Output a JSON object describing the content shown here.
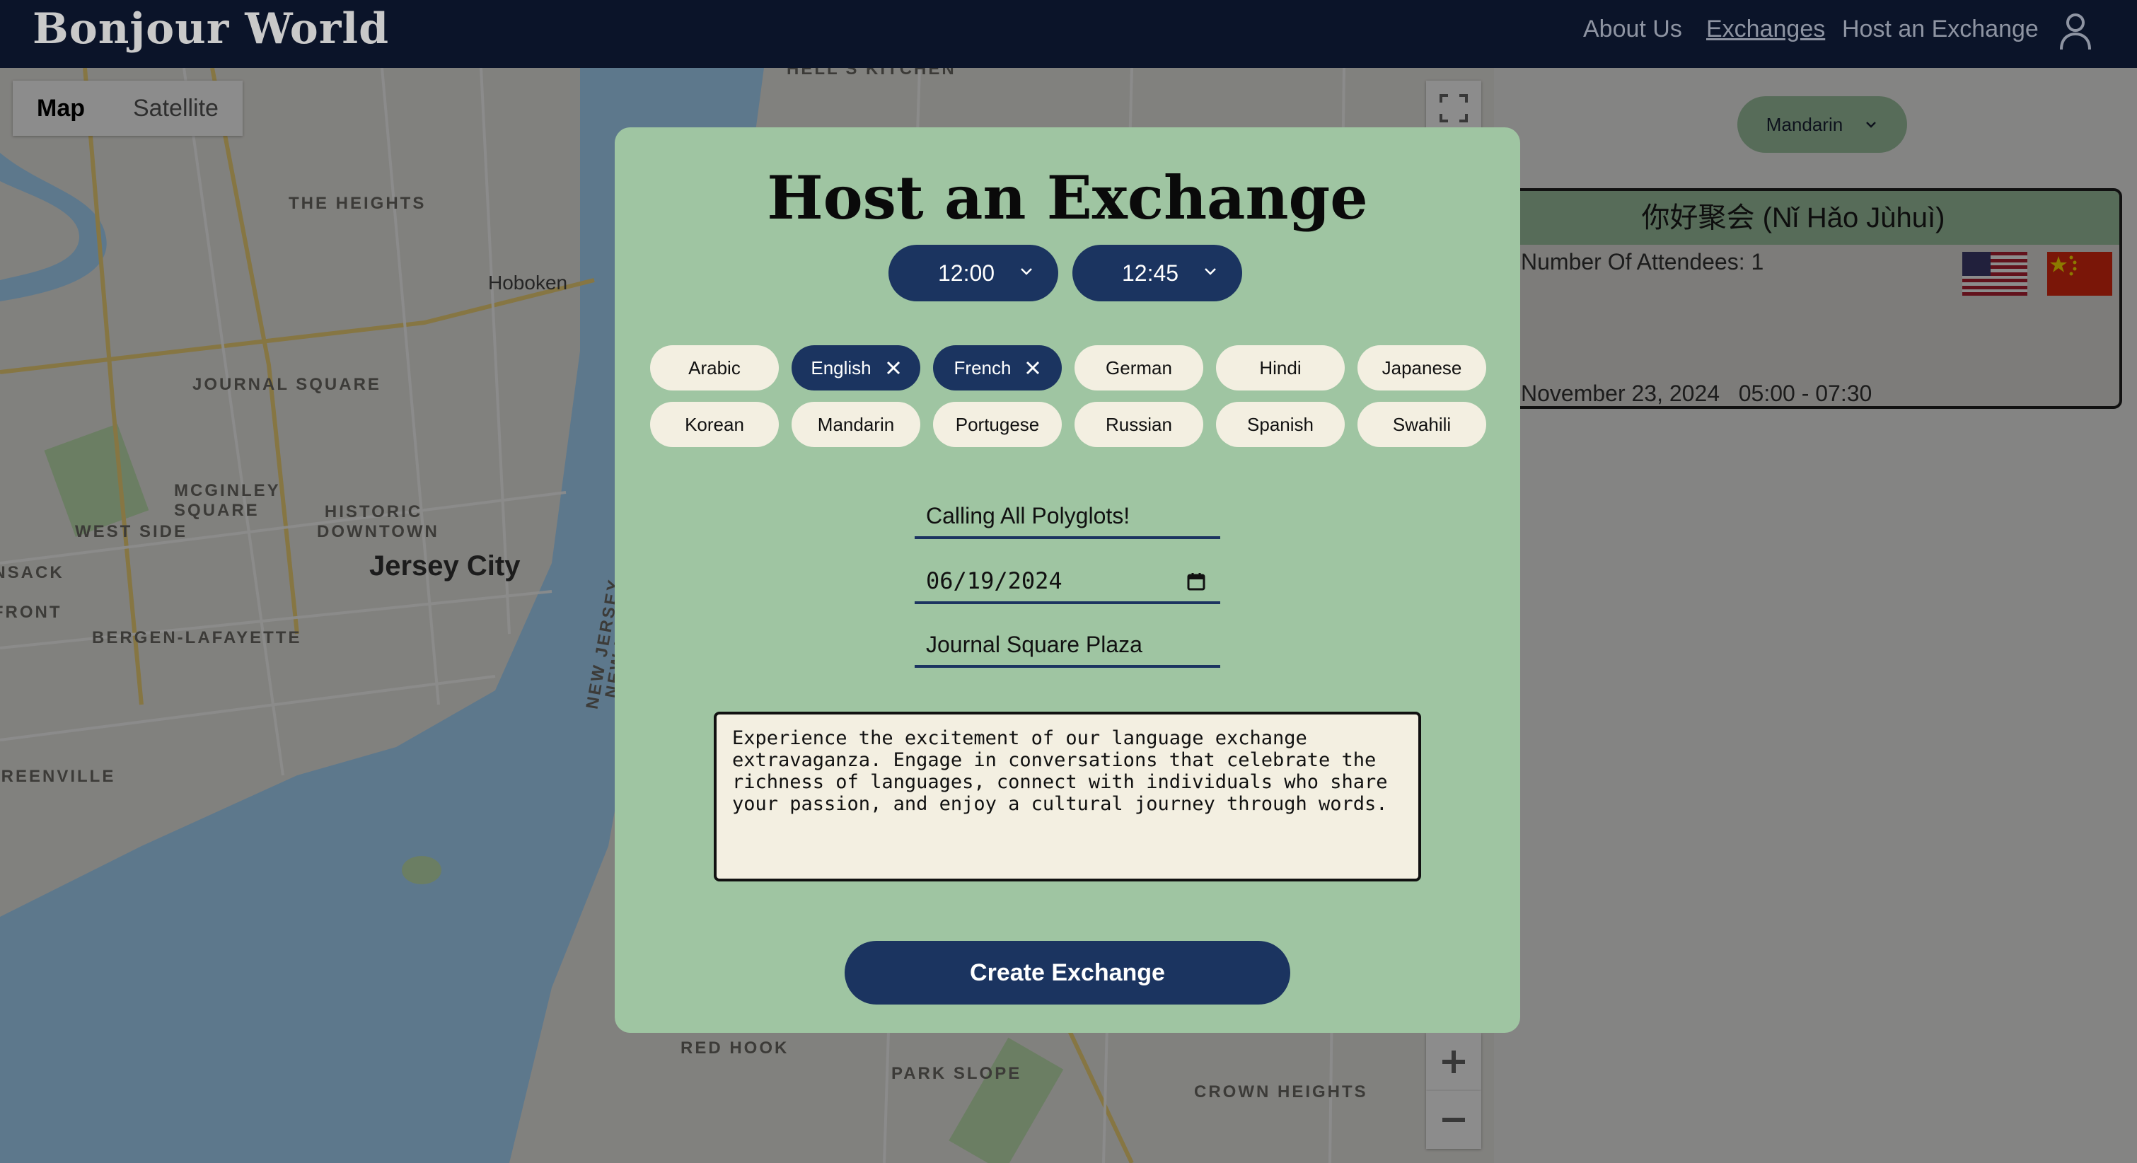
{
  "header": {
    "brand": "Bonjour World",
    "nav": [
      "About Us",
      "Exchanges",
      "Host an Exchange"
    ],
    "active_nav": "Exchanges",
    "user_icon": "user-icon"
  },
  "map": {
    "type_buttons": [
      "Map",
      "Satellite"
    ],
    "selected_type": "Map",
    "labels": [
      "HELL'S KITCHEN",
      "THE HEIGHTS",
      "Hoboken",
      "JOURNAL SQUARE",
      "MCGINLEY SQUARE",
      "WEST SIDE",
      "HISTORIC DOWNTOWN",
      "Jersey City",
      "BERGEN-LAFAYETTE",
      "GREENVILLE",
      "NEW JERSEY",
      "NEW YORK",
      "RED HOOK",
      "PARK SLOPE",
      "CROWN HEIGHTS",
      "HACKENSACK RIVER WATERFRONT"
    ],
    "controls": [
      "fullscreen-icon",
      "zoom-in-icon",
      "zoom-out-icon"
    ]
  },
  "filter": {
    "selected_language": "Mandarin"
  },
  "event_card": {
    "title": "你好聚会 (Nǐ Hǎo Jùhuì)",
    "attendees": "Number Of Attendees: 1",
    "date": "November 23, 2024",
    "time": "05:00 - 07:30",
    "flags": [
      "us-flag-icon",
      "china-flag-icon"
    ]
  },
  "modal": {
    "title": "Host an Exchange",
    "start_time": "12:00",
    "end_time": "12:45",
    "languages": [
      {
        "label": "Arabic",
        "selected": false
      },
      {
        "label": "English",
        "selected": true
      },
      {
        "label": "French",
        "selected": true
      },
      {
        "label": "German",
        "selected": false
      },
      {
        "label": "Hindi",
        "selected": false
      },
      {
        "label": "Japanese",
        "selected": false
      },
      {
        "label": "Korean",
        "selected": false
      },
      {
        "label": "Mandarin",
        "selected": false
      },
      {
        "label": "Portugese",
        "selected": false
      },
      {
        "label": "Russian",
        "selected": false
      },
      {
        "label": "Spanish",
        "selected": false
      },
      {
        "label": "Swahili",
        "selected": false
      }
    ],
    "event_name": "Calling All Polyglots!",
    "event_date": "06/19/2024",
    "location": "Journal Square Plaza",
    "description": "Experience the excitement of our language exchange\nextravaganza. Engage in conversations that celebrate the\nrichness of languages, connect with individuals who share\nyour passion, and enjoy a cultural journey through words.",
    "submit_label": "Create Exchange"
  },
  "colors": {
    "header_bg": "#0b1429",
    "modal_bg": "#9fc5a2",
    "accent_navy": "#1b3460",
    "chip_bg": "#f3efe1"
  }
}
